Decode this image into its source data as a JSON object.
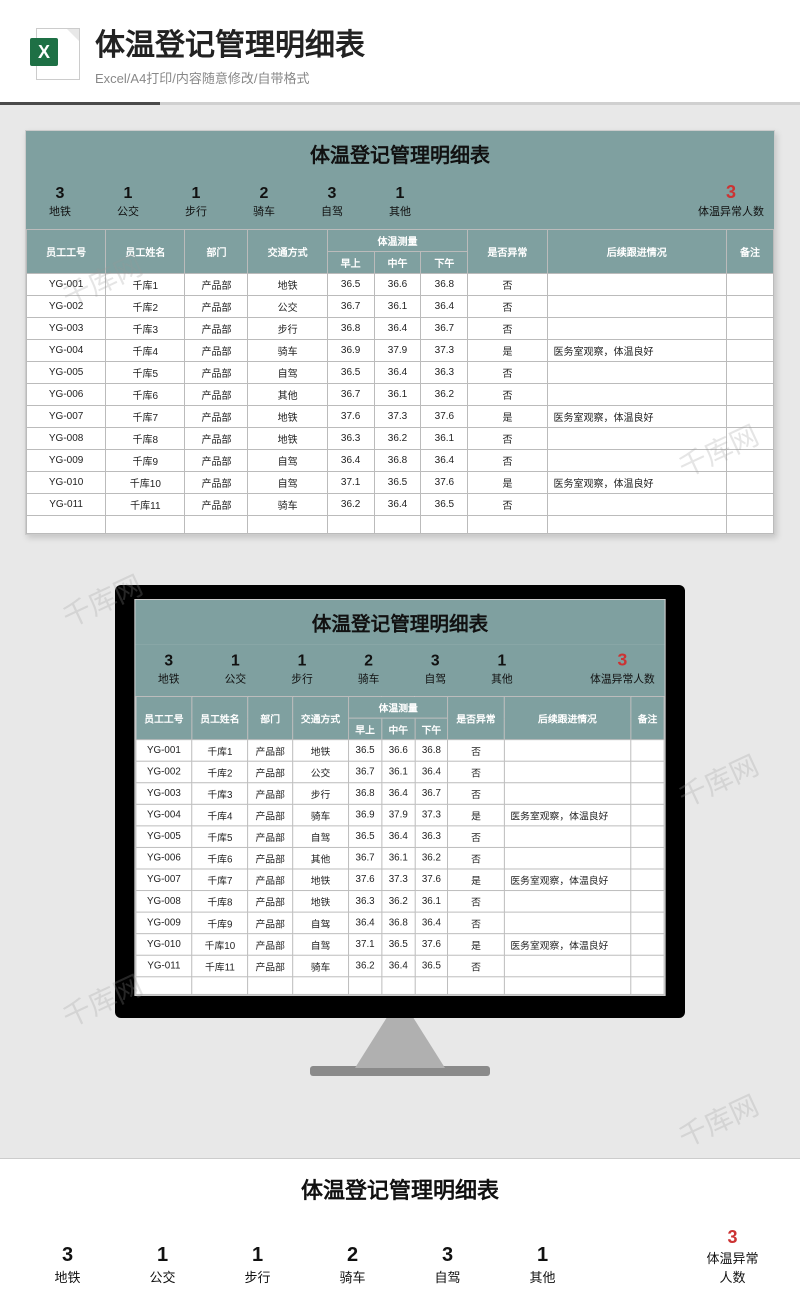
{
  "header": {
    "title": "体温登记管理明细表",
    "subtitle": "Excel/A4打印/内容随意修改/自带格式",
    "icon_letter": "X"
  },
  "sheet": {
    "title": "体温登记管理明细表",
    "summary": [
      {
        "num": "3",
        "label": "地铁"
      },
      {
        "num": "1",
        "label": "公交"
      },
      {
        "num": "1",
        "label": "步行"
      },
      {
        "num": "2",
        "label": "骑车"
      },
      {
        "num": "3",
        "label": "自驾"
      },
      {
        "num": "1",
        "label": "其他"
      }
    ],
    "abnormal": {
      "num": "3",
      "label": "体温异常人数"
    },
    "headers": {
      "id": "员工工号",
      "name": "员工姓名",
      "dept": "部门",
      "transport": "交通方式",
      "temp_group": "体温测量",
      "morning": "早上",
      "noon": "中午",
      "afternoon": "下午",
      "abnormal": "是否异常",
      "followup": "后续跟进情况",
      "remark": "备注"
    },
    "rows": [
      {
        "id": "YG-001",
        "name": "千库1",
        "dept": "产品部",
        "tr": "地铁",
        "m": "36.5",
        "n": "36.6",
        "a": "36.8",
        "ab": "否",
        "fu": "",
        "rm": ""
      },
      {
        "id": "YG-002",
        "name": "千库2",
        "dept": "产品部",
        "tr": "公交",
        "m": "36.7",
        "n": "36.1",
        "a": "36.4",
        "ab": "否",
        "fu": "",
        "rm": ""
      },
      {
        "id": "YG-003",
        "name": "千库3",
        "dept": "产品部",
        "tr": "步行",
        "m": "36.8",
        "n": "36.4",
        "a": "36.7",
        "ab": "否",
        "fu": "",
        "rm": ""
      },
      {
        "id": "YG-004",
        "name": "千库4",
        "dept": "产品部",
        "tr": "骑车",
        "m": "36.9",
        "n": "37.9",
        "a": "37.3",
        "ab": "是",
        "fu": "医务室观察，体温良好",
        "rm": ""
      },
      {
        "id": "YG-005",
        "name": "千库5",
        "dept": "产品部",
        "tr": "自驾",
        "m": "36.5",
        "n": "36.4",
        "a": "36.3",
        "ab": "否",
        "fu": "",
        "rm": ""
      },
      {
        "id": "YG-006",
        "name": "千库6",
        "dept": "产品部",
        "tr": "其他",
        "m": "36.7",
        "n": "36.1",
        "a": "36.2",
        "ab": "否",
        "fu": "",
        "rm": ""
      },
      {
        "id": "YG-007",
        "name": "千库7",
        "dept": "产品部",
        "tr": "地铁",
        "m": "37.6",
        "n": "37.3",
        "a": "37.6",
        "ab": "是",
        "fu": "医务室观察，体温良好",
        "rm": ""
      },
      {
        "id": "YG-008",
        "name": "千库8",
        "dept": "产品部",
        "tr": "地铁",
        "m": "36.3",
        "n": "36.2",
        "a": "36.1",
        "ab": "否",
        "fu": "",
        "rm": ""
      },
      {
        "id": "YG-009",
        "name": "千库9",
        "dept": "产品部",
        "tr": "自驾",
        "m": "36.4",
        "n": "36.8",
        "a": "36.4",
        "ab": "否",
        "fu": "",
        "rm": ""
      },
      {
        "id": "YG-010",
        "name": "千库10",
        "dept": "产品部",
        "tr": "自驾",
        "m": "37.1",
        "n": "36.5",
        "a": "37.6",
        "ab": "是",
        "fu": "医务室观察，体温良好",
        "rm": ""
      },
      {
        "id": "YG-011",
        "name": "千库11",
        "dept": "产品部",
        "tr": "骑车",
        "m": "36.2",
        "n": "36.4",
        "a": "36.5",
        "ab": "否",
        "fu": "",
        "rm": ""
      }
    ]
  },
  "watermark": "千库网"
}
